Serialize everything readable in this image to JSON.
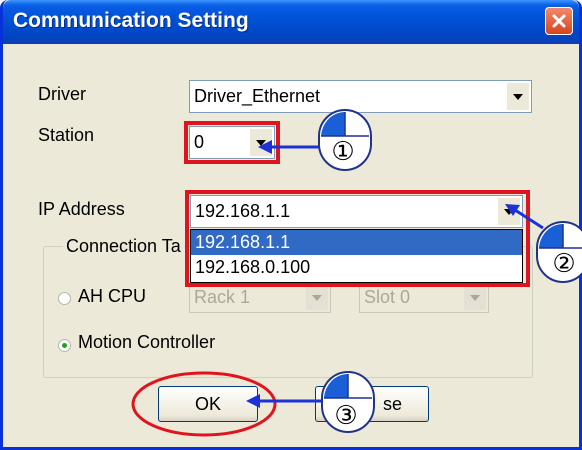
{
  "window": {
    "title": "Communication Setting"
  },
  "form": {
    "driver_label": "Driver",
    "driver_value": "Driver_Ethernet",
    "station_label": "Station",
    "station_value": "0",
    "ip_label": "IP Address",
    "ip_value": "192.168.1.1",
    "ip_options": [
      "192.168.1.1",
      "192.168.0.100"
    ],
    "connection_label": "Connection Ta",
    "ah_cpu_label": "AH CPU",
    "rack_value": "Rack 1",
    "slot_value": "Slot 0",
    "motion_label": "Motion Controller"
  },
  "buttons": {
    "ok_label": "OK",
    "close_label_visible": "se"
  },
  "annotations": {
    "step1": "①",
    "step2": "②",
    "step3": "③",
    "highlight_color": "#e0141e",
    "arrow_color": "#1d31d6"
  }
}
